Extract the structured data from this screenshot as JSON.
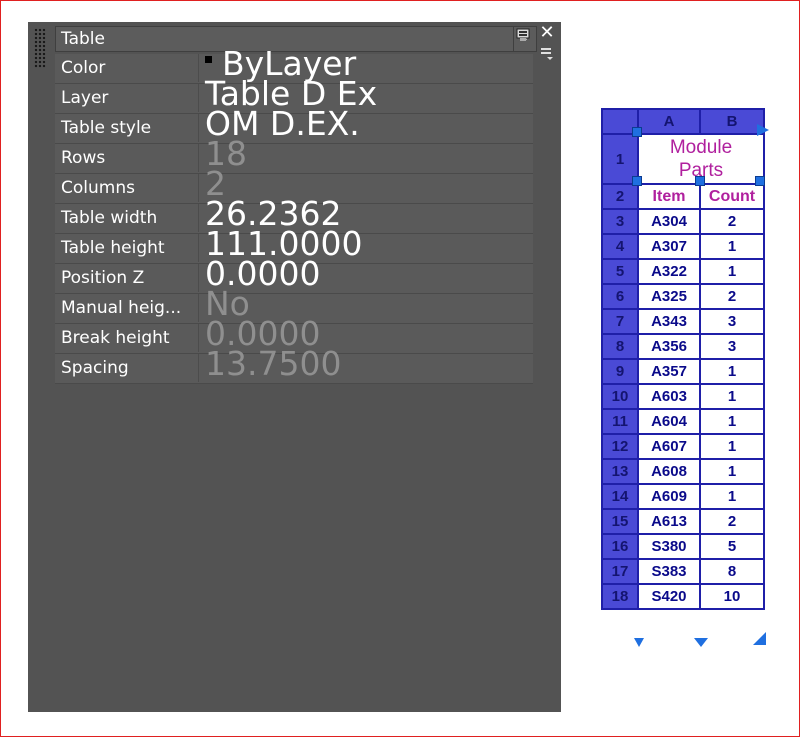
{
  "palette": {
    "selector_value": "Table",
    "properties": [
      {
        "name": "Color",
        "value": "ByLayer",
        "swatch": "#000000",
        "dim": false
      },
      {
        "name": "Layer",
        "value": "Table D Ex",
        "dim": false
      },
      {
        "name": "Table style",
        "value": "OM D.EX.",
        "dim": false
      },
      {
        "name": "Rows",
        "value": "18",
        "dim": true
      },
      {
        "name": "Columns",
        "value": "2",
        "dim": true
      },
      {
        "name": "Table width",
        "value": "26.2362",
        "dim": false
      },
      {
        "name": "Table height",
        "value": "111.0000",
        "dim": false
      },
      {
        "name": "Position Z",
        "value": "0.0000",
        "dim": false
      },
      {
        "name": "Manual heig...",
        "value": "No",
        "dim": true
      },
      {
        "name": "Break height",
        "value": "0.0000",
        "dim": true
      },
      {
        "name": "Spacing",
        "value": "13.7500",
        "dim": true
      }
    ],
    "icons": {
      "close": "close-icon",
      "menu": "options-menu-icon",
      "quick_select": "quick-select-icon",
      "grip": "drag-grip-icon"
    },
    "colors": {
      "background": "#535353",
      "row": "#5a5a5a",
      "text": "#ffffff",
      "dim_text": "#8f8f8f"
    }
  },
  "drawing_table": {
    "column_headers": [
      "A",
      "B"
    ],
    "title_row_number": "1",
    "title": "Module Parts",
    "header_row_number": "2",
    "header": [
      "Item",
      "Count"
    ],
    "rows": [
      {
        "num": "3",
        "item": "A304",
        "count": "2"
      },
      {
        "num": "4",
        "item": "A307",
        "count": "1"
      },
      {
        "num": "5",
        "item": "A322",
        "count": "1"
      },
      {
        "num": "6",
        "item": "A325",
        "count": "2"
      },
      {
        "num": "7",
        "item": "A343",
        "count": "3"
      },
      {
        "num": "8",
        "item": "A356",
        "count": "3"
      },
      {
        "num": "9",
        "item": "A357",
        "count": "1"
      },
      {
        "num": "10",
        "item": "A603",
        "count": "1"
      },
      {
        "num": "11",
        "item": "A604",
        "count": "1"
      },
      {
        "num": "12",
        "item": "A607",
        "count": "1"
      },
      {
        "num": "13",
        "item": "A608",
        "count": "1"
      },
      {
        "num": "14",
        "item": "A609",
        "count": "1"
      },
      {
        "num": "15",
        "item": "A613",
        "count": "2"
      },
      {
        "num": "16",
        "item": "S380",
        "count": "5"
      },
      {
        "num": "17",
        "item": "S383",
        "count": "8"
      },
      {
        "num": "18",
        "item": "S420",
        "count": "10"
      }
    ],
    "colors": {
      "border": "#1f1fa8",
      "header_fill": "#4a4ad6",
      "title_text": "#b0209e",
      "cell_text": "#0a0a8a",
      "grip": "#1f6fe0"
    }
  }
}
